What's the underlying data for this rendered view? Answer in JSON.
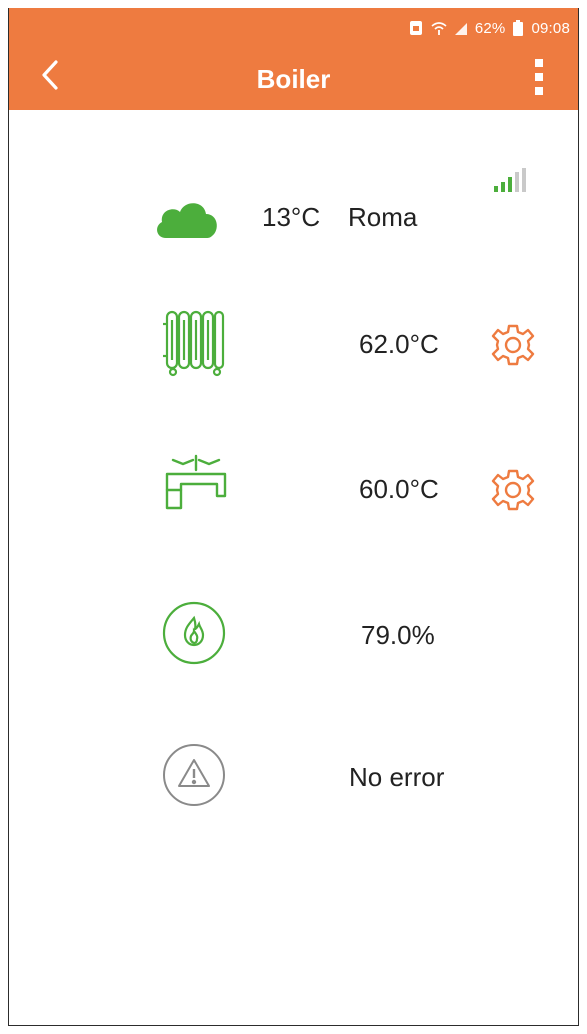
{
  "status_bar": {
    "battery_percent": "62%",
    "time": "09:08",
    "icons": [
      "sim-icon",
      "wifi-icon",
      "signal-icon",
      "battery-icon"
    ]
  },
  "header": {
    "title": "Boiler",
    "back_icon": "chevron-left-icon",
    "menu_icon": "more-vertical-icon"
  },
  "weather": {
    "temperature": "13°C",
    "city": "Roma",
    "icon": "cloud-icon",
    "signal_icon": "signal-strength-icon"
  },
  "heating": {
    "value": "62.0°C",
    "icon": "radiator-icon",
    "settings_icon": "gear-icon"
  },
  "hot_water": {
    "value": "60.0°C",
    "icon": "faucet-icon",
    "settings_icon": "gear-icon"
  },
  "flame": {
    "value": "79.0%",
    "icon": "flame-icon"
  },
  "error": {
    "value": "No error",
    "icon": "warning-icon"
  },
  "colors": {
    "header": "#ee7b40",
    "accent_green": "#4cae3c",
    "gear_orange": "#ee7b40",
    "text": "#222222"
  }
}
